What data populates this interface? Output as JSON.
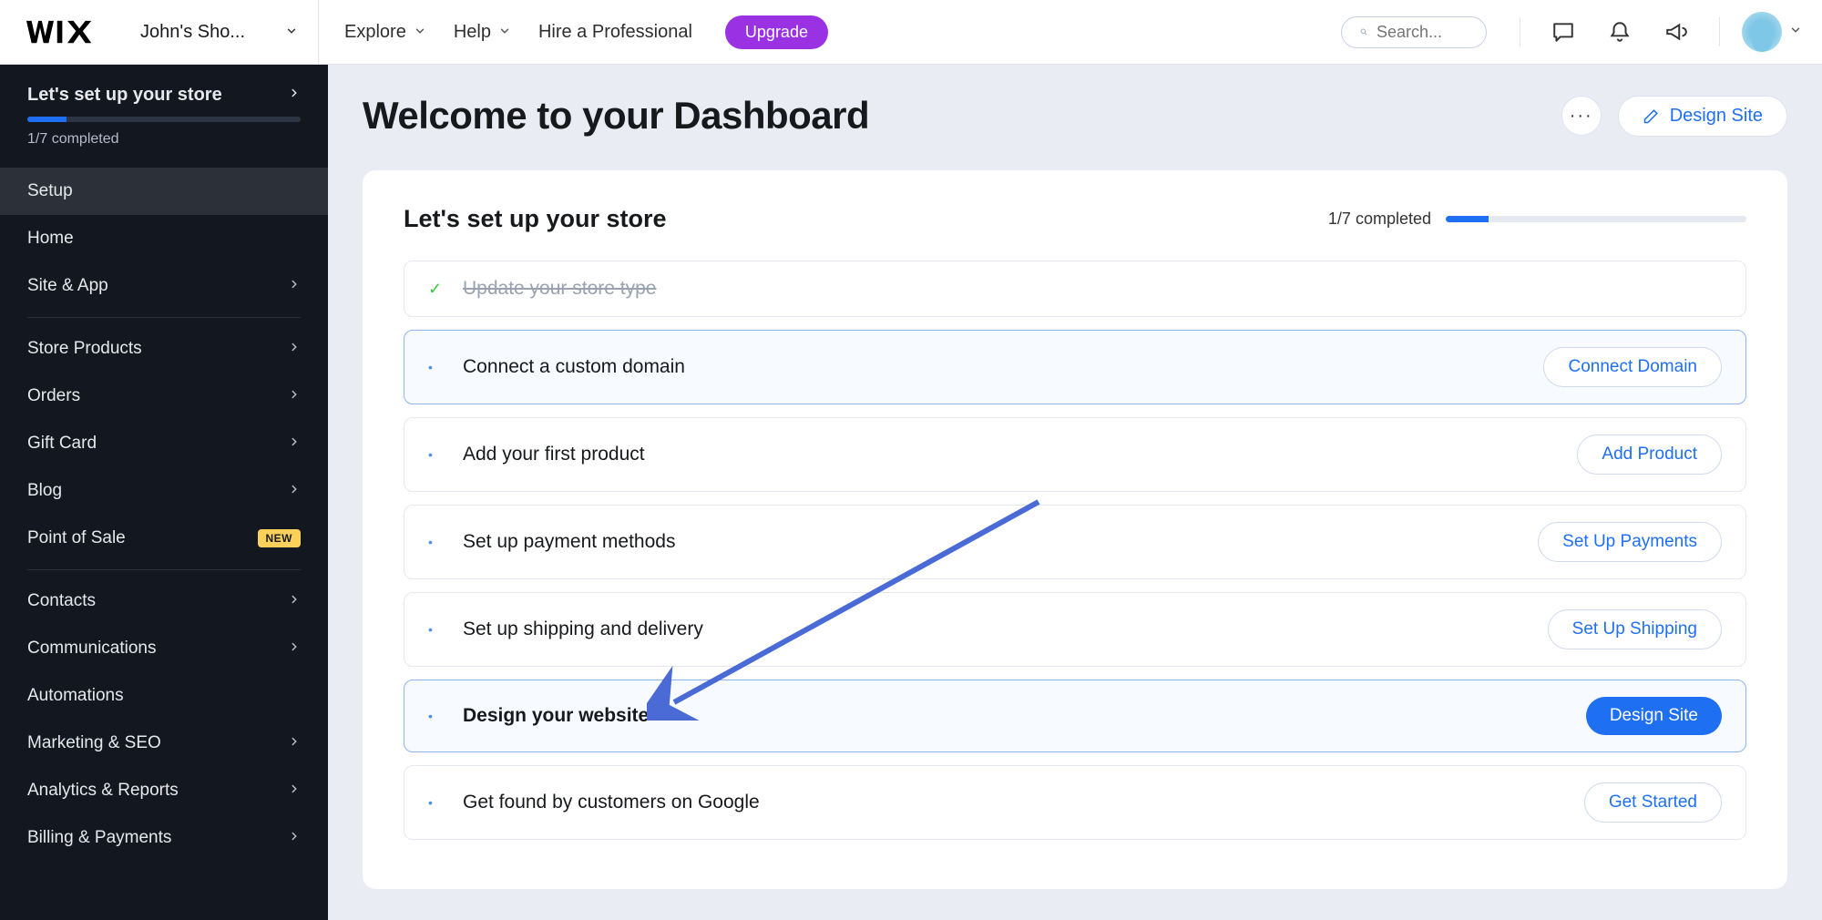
{
  "topbar": {
    "site_name": "John's Sho...",
    "explore": "Explore",
    "help": "Help",
    "hire": "Hire a Professional",
    "upgrade": "Upgrade",
    "search_placeholder": "Search..."
  },
  "sidebar": {
    "setup_header": "Let's set up your store",
    "progress_text": "1/7 completed",
    "items": [
      {
        "label": "Setup",
        "active": true,
        "chevron": false
      },
      {
        "label": "Home",
        "chevron": false
      },
      {
        "label": "Site & App",
        "chevron": true
      }
    ],
    "group2": [
      {
        "label": "Store Products",
        "chevron": true
      },
      {
        "label": "Orders",
        "chevron": true
      },
      {
        "label": "Gift Card",
        "chevron": true
      },
      {
        "label": "Blog",
        "chevron": true
      },
      {
        "label": "Point of Sale",
        "chevron": false,
        "badge": "NEW"
      }
    ],
    "group3": [
      {
        "label": "Contacts",
        "chevron": true
      },
      {
        "label": "Communications",
        "chevron": true
      },
      {
        "label": "Automations",
        "chevron": false
      },
      {
        "label": "Marketing & SEO",
        "chevron": true
      },
      {
        "label": "Analytics & Reports",
        "chevron": true
      },
      {
        "label": "Billing & Payments",
        "chevron": true
      }
    ]
  },
  "main": {
    "title": "Welcome to your Dashboard",
    "design_site": "Design Site",
    "card_title": "Let's set up your store",
    "card_progress": "1/7 completed",
    "steps": [
      {
        "label": "Update your store type",
        "done": true
      },
      {
        "label": "Connect a custom domain",
        "button": "Connect Domain",
        "highlighted": true
      },
      {
        "label": "Add your first product",
        "button": "Add Product"
      },
      {
        "label": "Set up payment methods",
        "button": "Set Up Payments"
      },
      {
        "label": "Set up shipping and delivery",
        "button": "Set Up Shipping"
      },
      {
        "label": "Design your website",
        "button": "Design Site",
        "highlighted": true,
        "emphasis": true,
        "primary": true
      },
      {
        "label": "Get found by customers on Google",
        "button": "Get Started"
      }
    ]
  }
}
